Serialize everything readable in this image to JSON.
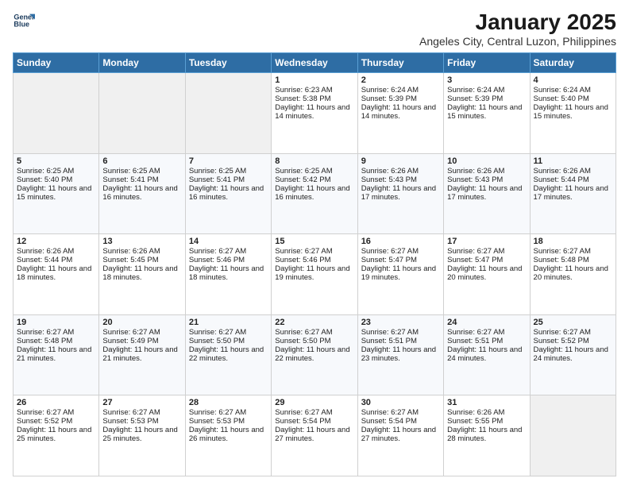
{
  "logo": {
    "line1": "General",
    "line2": "Blue"
  },
  "title": "January 2025",
  "subtitle": "Angeles City, Central Luzon, Philippines",
  "days_of_week": [
    "Sunday",
    "Monday",
    "Tuesday",
    "Wednesday",
    "Thursday",
    "Friday",
    "Saturday"
  ],
  "weeks": [
    [
      {
        "day": "",
        "info": ""
      },
      {
        "day": "",
        "info": ""
      },
      {
        "day": "",
        "info": ""
      },
      {
        "day": "1",
        "sunrise": "6:23 AM",
        "sunset": "5:38 PM",
        "daylight": "11 hours and 14 minutes."
      },
      {
        "day": "2",
        "sunrise": "6:24 AM",
        "sunset": "5:39 PM",
        "daylight": "11 hours and 14 minutes."
      },
      {
        "day": "3",
        "sunrise": "6:24 AM",
        "sunset": "5:39 PM",
        "daylight": "11 hours and 15 minutes."
      },
      {
        "day": "4",
        "sunrise": "6:24 AM",
        "sunset": "5:40 PM",
        "daylight": "11 hours and 15 minutes."
      }
    ],
    [
      {
        "day": "5",
        "sunrise": "6:25 AM",
        "sunset": "5:40 PM",
        "daylight": "11 hours and 15 minutes."
      },
      {
        "day": "6",
        "sunrise": "6:25 AM",
        "sunset": "5:41 PM",
        "daylight": "11 hours and 16 minutes."
      },
      {
        "day": "7",
        "sunrise": "6:25 AM",
        "sunset": "5:41 PM",
        "daylight": "11 hours and 16 minutes."
      },
      {
        "day": "8",
        "sunrise": "6:25 AM",
        "sunset": "5:42 PM",
        "daylight": "11 hours and 16 minutes."
      },
      {
        "day": "9",
        "sunrise": "6:26 AM",
        "sunset": "5:43 PM",
        "daylight": "11 hours and 17 minutes."
      },
      {
        "day": "10",
        "sunrise": "6:26 AM",
        "sunset": "5:43 PM",
        "daylight": "11 hours and 17 minutes."
      },
      {
        "day": "11",
        "sunrise": "6:26 AM",
        "sunset": "5:44 PM",
        "daylight": "11 hours and 17 minutes."
      }
    ],
    [
      {
        "day": "12",
        "sunrise": "6:26 AM",
        "sunset": "5:44 PM",
        "daylight": "11 hours and 18 minutes."
      },
      {
        "day": "13",
        "sunrise": "6:26 AM",
        "sunset": "5:45 PM",
        "daylight": "11 hours and 18 minutes."
      },
      {
        "day": "14",
        "sunrise": "6:27 AM",
        "sunset": "5:46 PM",
        "daylight": "11 hours and 18 minutes."
      },
      {
        "day": "15",
        "sunrise": "6:27 AM",
        "sunset": "5:46 PM",
        "daylight": "11 hours and 19 minutes."
      },
      {
        "day": "16",
        "sunrise": "6:27 AM",
        "sunset": "5:47 PM",
        "daylight": "11 hours and 19 minutes."
      },
      {
        "day": "17",
        "sunrise": "6:27 AM",
        "sunset": "5:47 PM",
        "daylight": "11 hours and 20 minutes."
      },
      {
        "day": "18",
        "sunrise": "6:27 AM",
        "sunset": "5:48 PM",
        "daylight": "11 hours and 20 minutes."
      }
    ],
    [
      {
        "day": "19",
        "sunrise": "6:27 AM",
        "sunset": "5:48 PM",
        "daylight": "11 hours and 21 minutes."
      },
      {
        "day": "20",
        "sunrise": "6:27 AM",
        "sunset": "5:49 PM",
        "daylight": "11 hours and 21 minutes."
      },
      {
        "day": "21",
        "sunrise": "6:27 AM",
        "sunset": "5:50 PM",
        "daylight": "11 hours and 22 minutes."
      },
      {
        "day": "22",
        "sunrise": "6:27 AM",
        "sunset": "5:50 PM",
        "daylight": "11 hours and 22 minutes."
      },
      {
        "day": "23",
        "sunrise": "6:27 AM",
        "sunset": "5:51 PM",
        "daylight": "11 hours and 23 minutes."
      },
      {
        "day": "24",
        "sunrise": "6:27 AM",
        "sunset": "5:51 PM",
        "daylight": "11 hours and 24 minutes."
      },
      {
        "day": "25",
        "sunrise": "6:27 AM",
        "sunset": "5:52 PM",
        "daylight": "11 hours and 24 minutes."
      }
    ],
    [
      {
        "day": "26",
        "sunrise": "6:27 AM",
        "sunset": "5:52 PM",
        "daylight": "11 hours and 25 minutes."
      },
      {
        "day": "27",
        "sunrise": "6:27 AM",
        "sunset": "5:53 PM",
        "daylight": "11 hours and 25 minutes."
      },
      {
        "day": "28",
        "sunrise": "6:27 AM",
        "sunset": "5:53 PM",
        "daylight": "11 hours and 26 minutes."
      },
      {
        "day": "29",
        "sunrise": "6:27 AM",
        "sunset": "5:54 PM",
        "daylight": "11 hours and 27 minutes."
      },
      {
        "day": "30",
        "sunrise": "6:27 AM",
        "sunset": "5:54 PM",
        "daylight": "11 hours and 27 minutes."
      },
      {
        "day": "31",
        "sunrise": "6:26 AM",
        "sunset": "5:55 PM",
        "daylight": "11 hours and 28 minutes."
      },
      {
        "day": "",
        "info": ""
      }
    ]
  ],
  "labels": {
    "sunrise": "Sunrise:",
    "sunset": "Sunset:",
    "daylight": "Daylight:"
  }
}
